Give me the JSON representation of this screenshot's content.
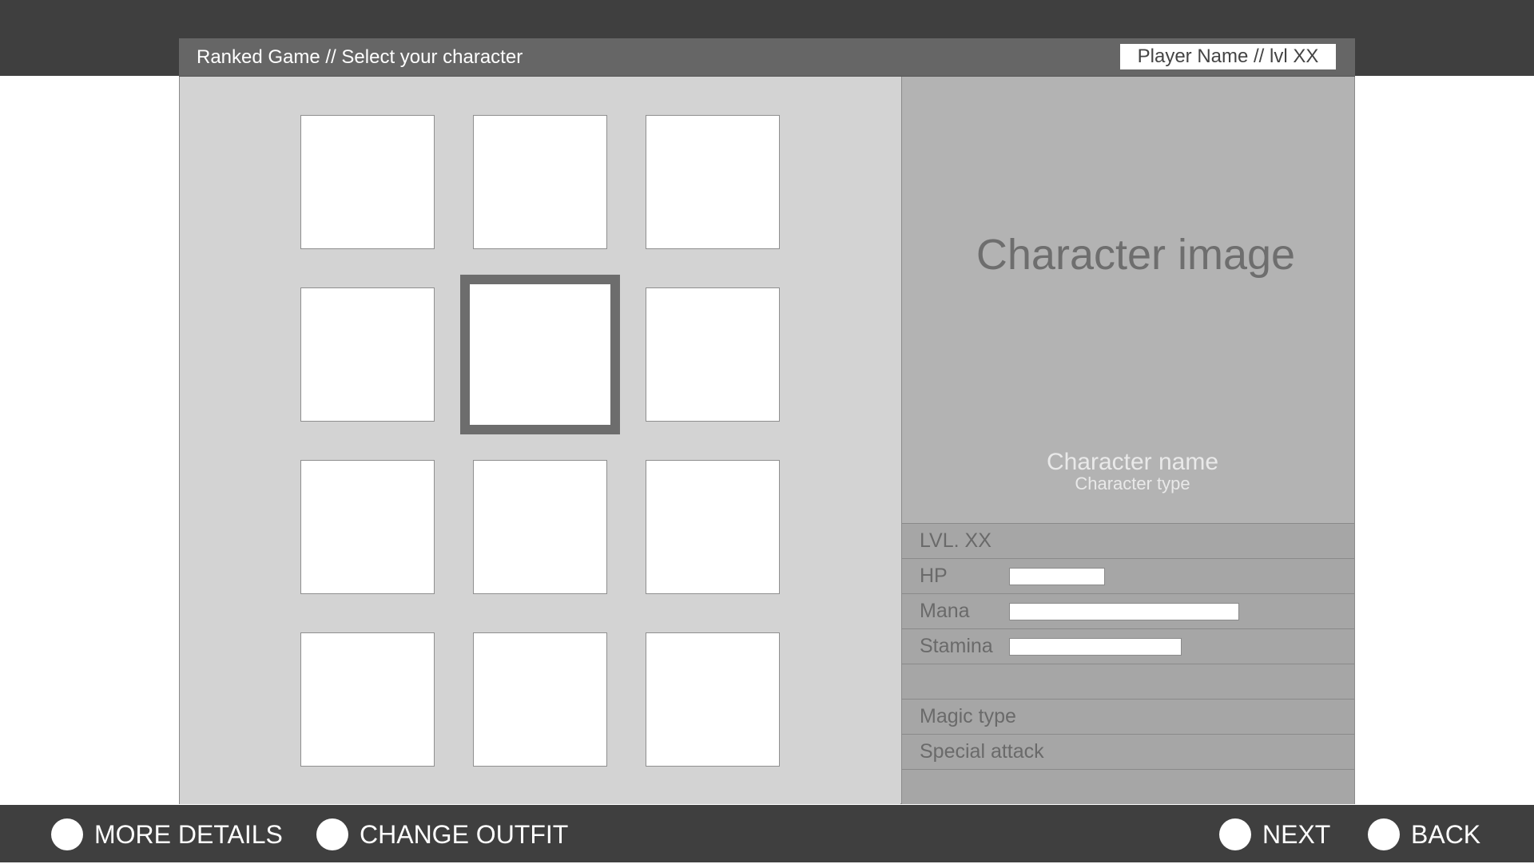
{
  "header": {
    "title": "Ranked Game // Select your character",
    "player": "Player Name // lvl XX"
  },
  "character_grid": {
    "rows": 4,
    "columns": 3,
    "selected_row": 2,
    "selected_column": 2
  },
  "character": {
    "image_label": "Character image",
    "name": "Character name",
    "type": "Character type"
  },
  "stats": {
    "level": "LVL. XX",
    "hp_label": "HP",
    "mana_label": "Mana",
    "stamina_label": "Stamina",
    "magic_type": "Magic type",
    "special_attack": "Special attack"
  },
  "footer": {
    "more_details": "MORE DETAILS",
    "change_outfit": "CHANGE OUTFIT",
    "next": "NEXT",
    "back": "BACK"
  },
  "colors": {
    "dark_band": "#3f3f3f",
    "header_bar": "#666666",
    "grid_bg": "#d3d3d3",
    "info_bg": "#b3b3b3",
    "selected_border": "#6d6d6d"
  }
}
